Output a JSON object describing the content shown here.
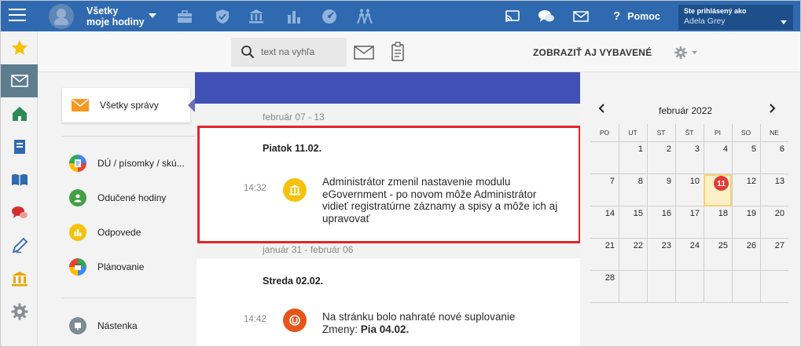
{
  "topbar": {
    "title_line1": "Všetky",
    "title_line2": "moje hodiny",
    "help_label": "Pomoc",
    "help_symbol": "?",
    "user_label": "Ste prihlásený ako",
    "user_name": "Adela Grey",
    "bg_color": "#2f6ab0"
  },
  "rail": {
    "items": [
      "star-icon",
      "mail-icon",
      "home-icon",
      "notebook-icon",
      "open-book-icon",
      "chat-icon",
      "pencil-icon",
      "bank-icon",
      "gear-icon"
    ],
    "active_index": 1
  },
  "toolbar": {
    "search_placeholder": "text na vyhľa",
    "show_equipped": "ZOBRAZIŤ AJ VYBAVENÉ"
  },
  "categories": {
    "all_messages": "Všetky správy",
    "items": [
      {
        "label": "DÚ / písomky / skú...",
        "color": "#2f6ab0"
      },
      {
        "label": "Odučené hodiny",
        "color": "#43a047"
      },
      {
        "label": "Odpovede",
        "color": "#f4c20d"
      },
      {
        "label": "Plánovanie",
        "color": "#e53935"
      },
      {
        "label": "Nástenka",
        "color": "#7e8a94"
      }
    ]
  },
  "feed": {
    "groups": [
      {
        "week": "február 07 - 13",
        "day": "Piatok 11.02.",
        "time": "14:32",
        "icon": "bank-icon",
        "icon_color": "#f4c20d",
        "text": "Administrátor zmenil nastavenie modulu eGovernment - po novom môže Administrátor vidieť registratúrne záznamy a spisy a môže ich aj upravovať"
      },
      {
        "week": "január 31 - február 06",
        "day": "Streda 02.02.",
        "time": "14:42",
        "icon": "substitution-icon",
        "icon_color": "#e4571b",
        "text_prefix": "Na stránku bolo nahraté nové suplovanie",
        "text_line2_label": "Zmeny: ",
        "text_line2_value": "Pia 04.02."
      }
    ]
  },
  "calendar": {
    "month": "február 2022",
    "weekdays": [
      "PO",
      "UT",
      "ST",
      "ŠT",
      "PI",
      "SO",
      "NE"
    ],
    "first_weekday_index": 1,
    "days_in_month": 28,
    "today": 11
  }
}
